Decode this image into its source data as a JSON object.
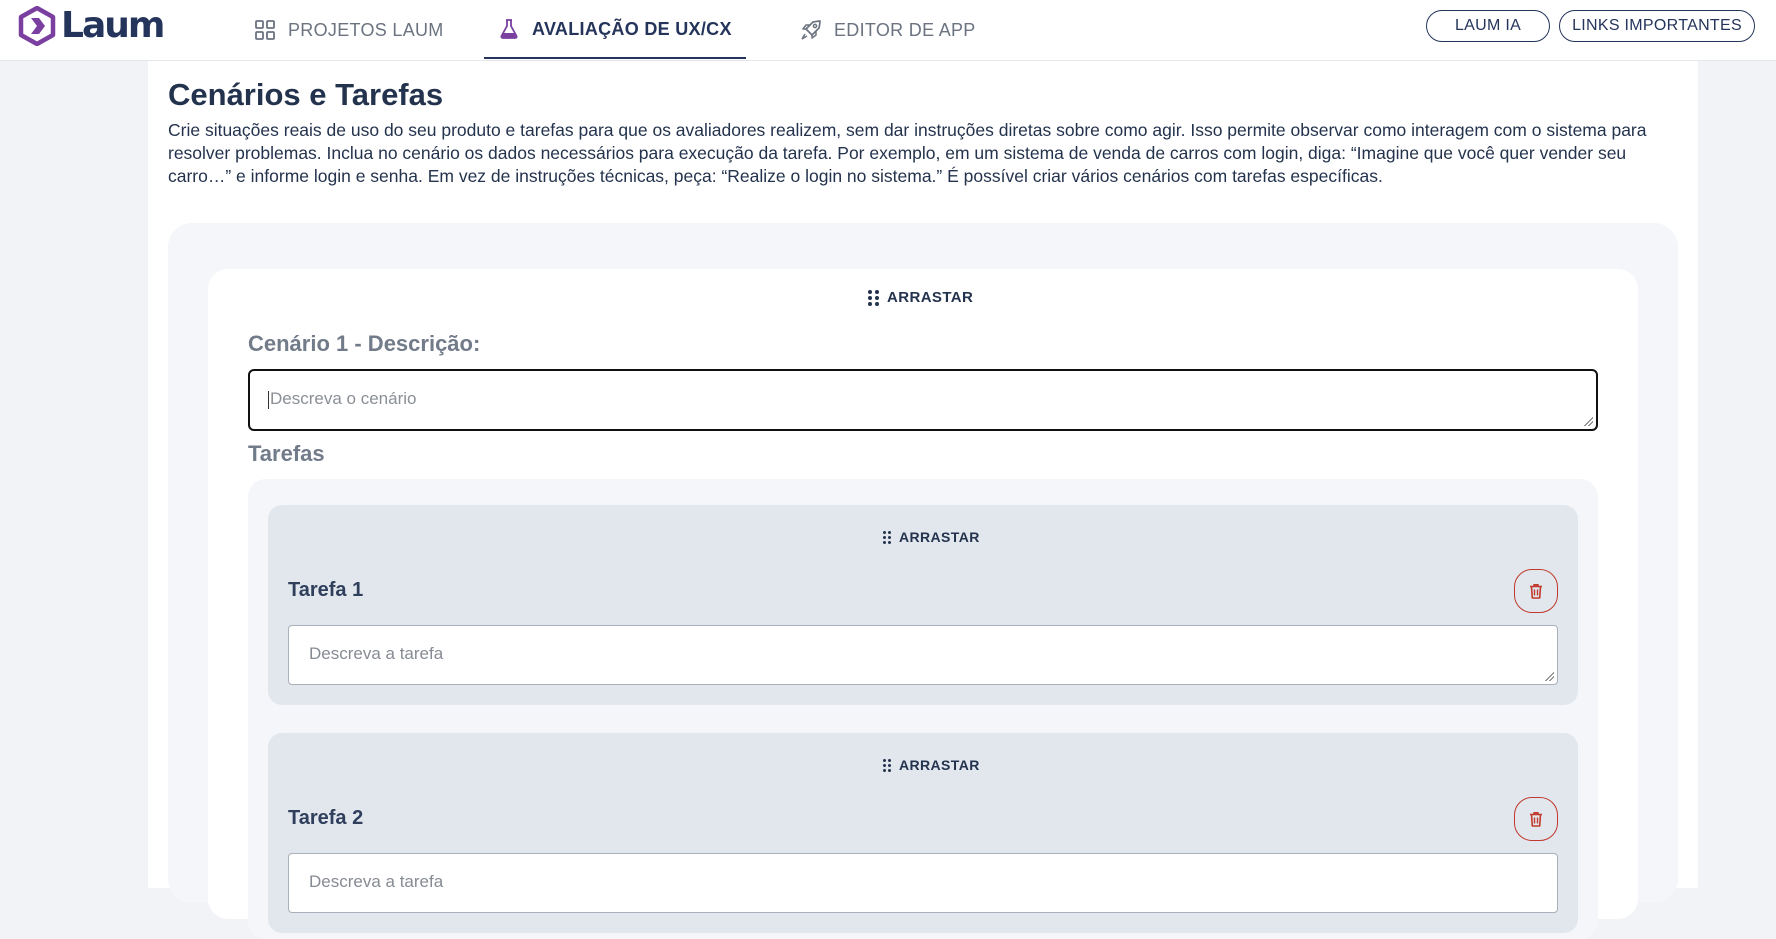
{
  "header": {
    "logo_text": "Laum",
    "tabs": [
      {
        "label": "PROJETOS LAUM",
        "icon": "grid-icon",
        "active": false
      },
      {
        "label": "AVALIAÇÃO DE UX/CX",
        "icon": "flask-icon",
        "active": true
      },
      {
        "label": "EDITOR DE APP",
        "icon": "rocket-icon",
        "active": false
      }
    ],
    "buttons": {
      "laum_ia": "LAUM IA",
      "links": "LINKS IMPORTANTES"
    }
  },
  "page": {
    "title": "Cenários e Tarefas",
    "description": "Crie situações reais de uso do seu produto e tarefas para que os avaliadores realizem, sem dar instruções diretas sobre como agir. Isso permite observar como interagem com o sistema para resolver problemas. Inclua no cenário os dados necessários para execução da tarefa. Por exemplo, em um sistema de venda de carros com login, diga: “Imagine que você quer vender seu carro…” e informe login e senha. Em vez de instruções técnicas, peça: “Realize o login no sistema.” É possível criar vários cenários com tarefas específicas."
  },
  "scenario": {
    "drag_label": "ARRASTAR",
    "label": "Cenário 1 - Descrição:",
    "placeholder": "Descreva o cenário",
    "tasks_label": "Tarefas",
    "tasks": [
      {
        "drag_label": "ARRASTAR",
        "title": "Tarefa 1",
        "placeholder": "Descreva a tarefa"
      },
      {
        "drag_label": "ARRASTAR",
        "title": "Tarefa 2",
        "placeholder": "Descreva a tarefa"
      }
    ]
  },
  "colors": {
    "brand_navy": "#24345a",
    "brand_purple": "#7b3fa0",
    "danger": "#c0392b"
  }
}
